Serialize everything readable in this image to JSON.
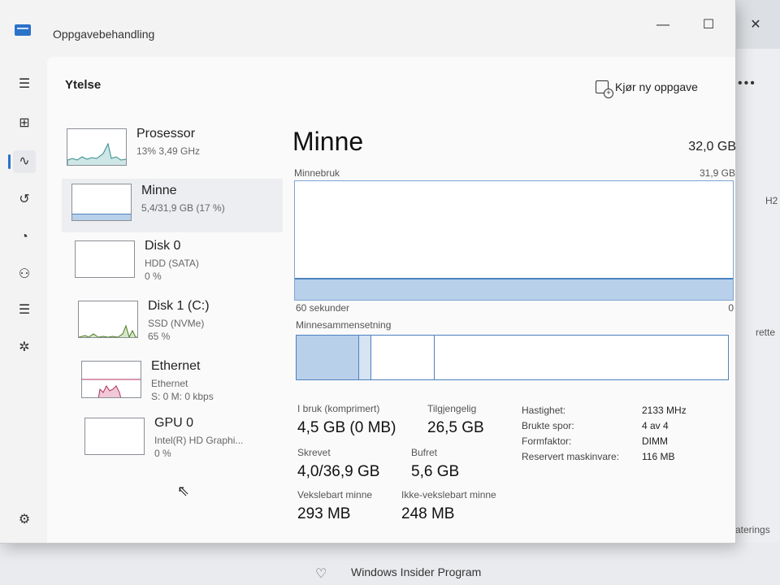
{
  "window": {
    "title": "Oppgavebehandling"
  },
  "header": {
    "page_title": "Ytelse",
    "run_task_label": "Kjør ny oppgave",
    "more_label": "•••"
  },
  "nav": {
    "items": [
      {
        "name": "hamburger-menu-icon",
        "glyph": "☰"
      },
      {
        "name": "processes-icon",
        "glyph": "⊞"
      },
      {
        "name": "performance-icon",
        "glyph": "∿"
      },
      {
        "name": "app-history-icon",
        "glyph": "↺"
      },
      {
        "name": "startup-apps-icon",
        "glyph": "◔"
      },
      {
        "name": "users-icon",
        "glyph": "⚇"
      },
      {
        "name": "details-icon",
        "glyph": "☰"
      },
      {
        "name": "services-icon",
        "glyph": "✲"
      },
      {
        "name": "settings-icon",
        "glyph": "⚙"
      }
    ]
  },
  "resources": [
    {
      "name": "Prosessor",
      "sub1": "13% 3,49 GHz",
      "sub2": "",
      "sub3": ""
    },
    {
      "name": "Minne",
      "sub1": "5,4/31,9 GB (17 %)",
      "sub2": "",
      "sub3": ""
    },
    {
      "name": "Disk 0",
      "sub1": "HDD (SATA)",
      "sub2": "0 %",
      "sub3": ""
    },
    {
      "name": "Disk 1 (C:)",
      "sub1": "SSD (NVMe)",
      "sub2": "65 %",
      "sub3": ""
    },
    {
      "name": "Ethernet",
      "sub1": "Ethernet",
      "sub2": "S: 0 M: 0 kbps",
      "sub3": ""
    },
    {
      "name": "GPU 0",
      "sub1": "Intel(R) HD Graphi...",
      "sub2": "0 %",
      "sub3": ""
    }
  ],
  "memory": {
    "title": "Minne",
    "total": "32,0 GB",
    "usage_label": "Minnebruk",
    "usage_max": "31,9 GB",
    "time_label": "60 sekunder",
    "time_end": "0",
    "composition_label": "Minnesammensetning",
    "usage_fraction": 0.17,
    "stats": {
      "in_use_label": "I bruk (komprimert)",
      "in_use_value": "4,5 GB (0 MB)",
      "available_label": "Tilgjengelig",
      "available_value": "26,5 GB",
      "committed_label": "Skrevet",
      "committed_value": "4,0/36,9 GB",
      "cached_label": "Bufret",
      "cached_value": "5,6 GB",
      "paged_label": "Vekslebart minne",
      "paged_value": "293 MB",
      "nonpaged_label": "Ikke-vekslebart minne",
      "nonpaged_value": "248 MB"
    },
    "specs": {
      "speed_label": "Hastighet:",
      "speed_value": "2133 MHz",
      "slots_label": "Brukte spor:",
      "slots_value": "4 av 4",
      "form_label": "Formfaktor:",
      "form_value": "DIMM",
      "reserved_label": "Reservert maskinvare:",
      "reserved_value": "116 MB"
    }
  },
  "background": {
    "right_text_1": "H2",
    "right_text_2": "rette",
    "right_text_3": "aterings",
    "bottom_label": "Windows Insider Program"
  },
  "colors": {
    "accent": "#2b72c9",
    "memory_line": "#4c82bf",
    "memory_fill": "#b9d0ea",
    "cpu_line": "#2e8b8b",
    "disk_line": "#4a7a1e",
    "ethernet_line": "#b03060"
  }
}
